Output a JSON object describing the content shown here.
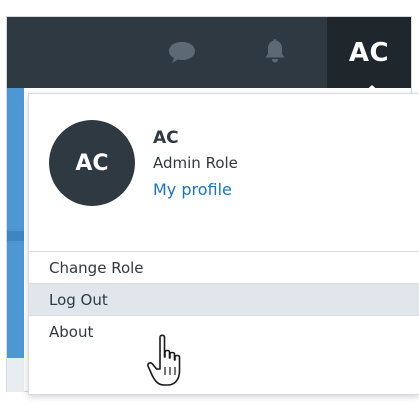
{
  "header": {
    "chat_icon": "chat-bubble-icon",
    "bell_icon": "bell-icon",
    "avatar_initials": "AC"
  },
  "profile": {
    "initials": "AC",
    "name": "AC",
    "role": "Admin Role",
    "link": "My profile"
  },
  "menu": {
    "items": [
      {
        "label": "Change Role"
      },
      {
        "label": "Log Out"
      },
      {
        "label": "About"
      }
    ],
    "hovered_index": 1
  },
  "colors": {
    "topbar": "#2f3941",
    "avatar_tab": "#1f272d",
    "link": "#1f73b7",
    "hover": "#e0e6eb",
    "accent_blue": "#4d97d4"
  }
}
